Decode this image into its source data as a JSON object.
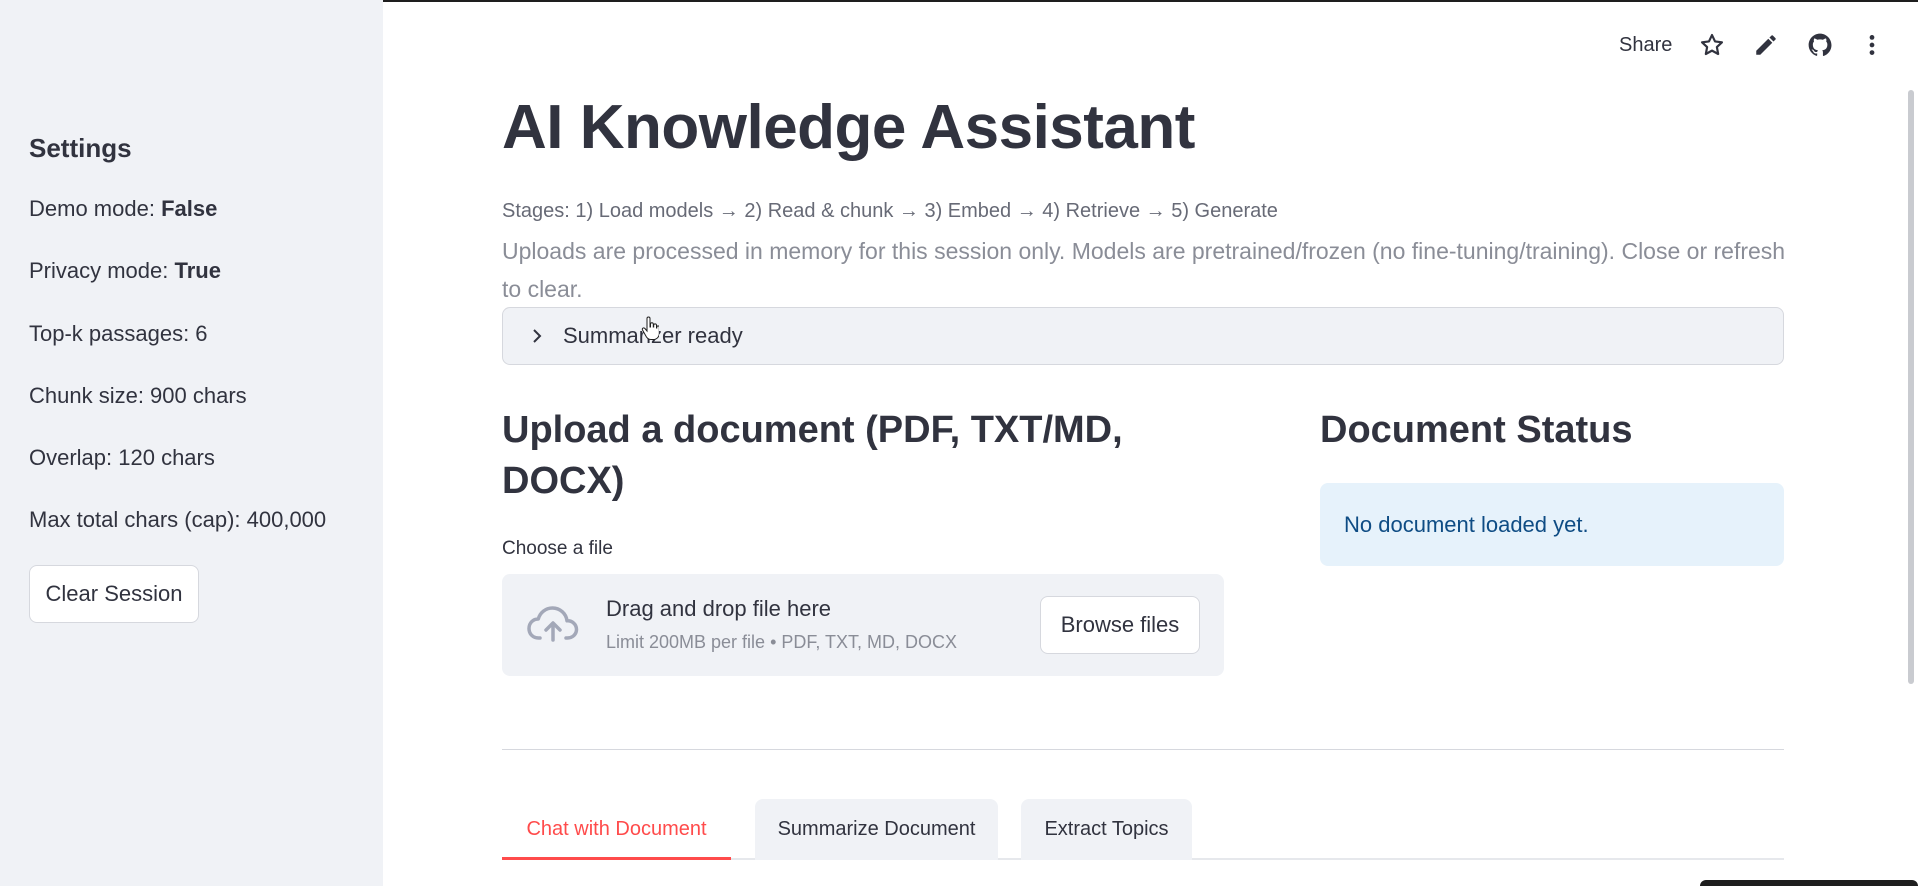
{
  "sidebar": {
    "title": "Settings",
    "demo_label": "Demo mode: ",
    "demo_value": "False",
    "privacy_label": "Privacy mode: ",
    "privacy_value": "True",
    "topk": "Top-k passages: 6",
    "chunk": "Chunk size: 900 chars",
    "overlap": "Overlap: 120 chars",
    "maxchars": "Max total chars (cap): 400,000",
    "clear_button": "Clear Session"
  },
  "header": {
    "share": "Share",
    "icons": [
      "star-icon",
      "edit-pencil-icon",
      "github-icon",
      "more-vertical-icon"
    ]
  },
  "main": {
    "title": "AI Knowledge Assistant",
    "stages": "Stages: 1) Load models → 2) Read & chunk → 3) Embed → 4) Retrieve → 5) Generate",
    "note": "Uploads are processed in memory for this session only. Models are pretrained/frozen (no fine-tuning/training). Close or refresh to clear.",
    "expander_label": "Summarizer ready",
    "upload_heading": "Upload a document (PDF, TXT/MD, DOCX)",
    "choose_label": "Choose a file",
    "dropzone_main": "Drag and drop file here",
    "dropzone_sub": "Limit 200MB per file • PDF, TXT, MD, DOCX",
    "browse_button": "Browse files",
    "status_heading": "Document Status",
    "status_message": "No document loaded yet."
  },
  "tabs": [
    {
      "label": "Chat with Document",
      "active": true
    },
    {
      "label": "Summarize Document",
      "active": false
    },
    {
      "label": "Extract Topics",
      "active": false
    }
  ],
  "colors": {
    "accent": "#ff4b4b",
    "sidebar_bg": "#f0f2f6",
    "info_bg": "#e6f2fb",
    "info_text": "#0e4c84"
  }
}
